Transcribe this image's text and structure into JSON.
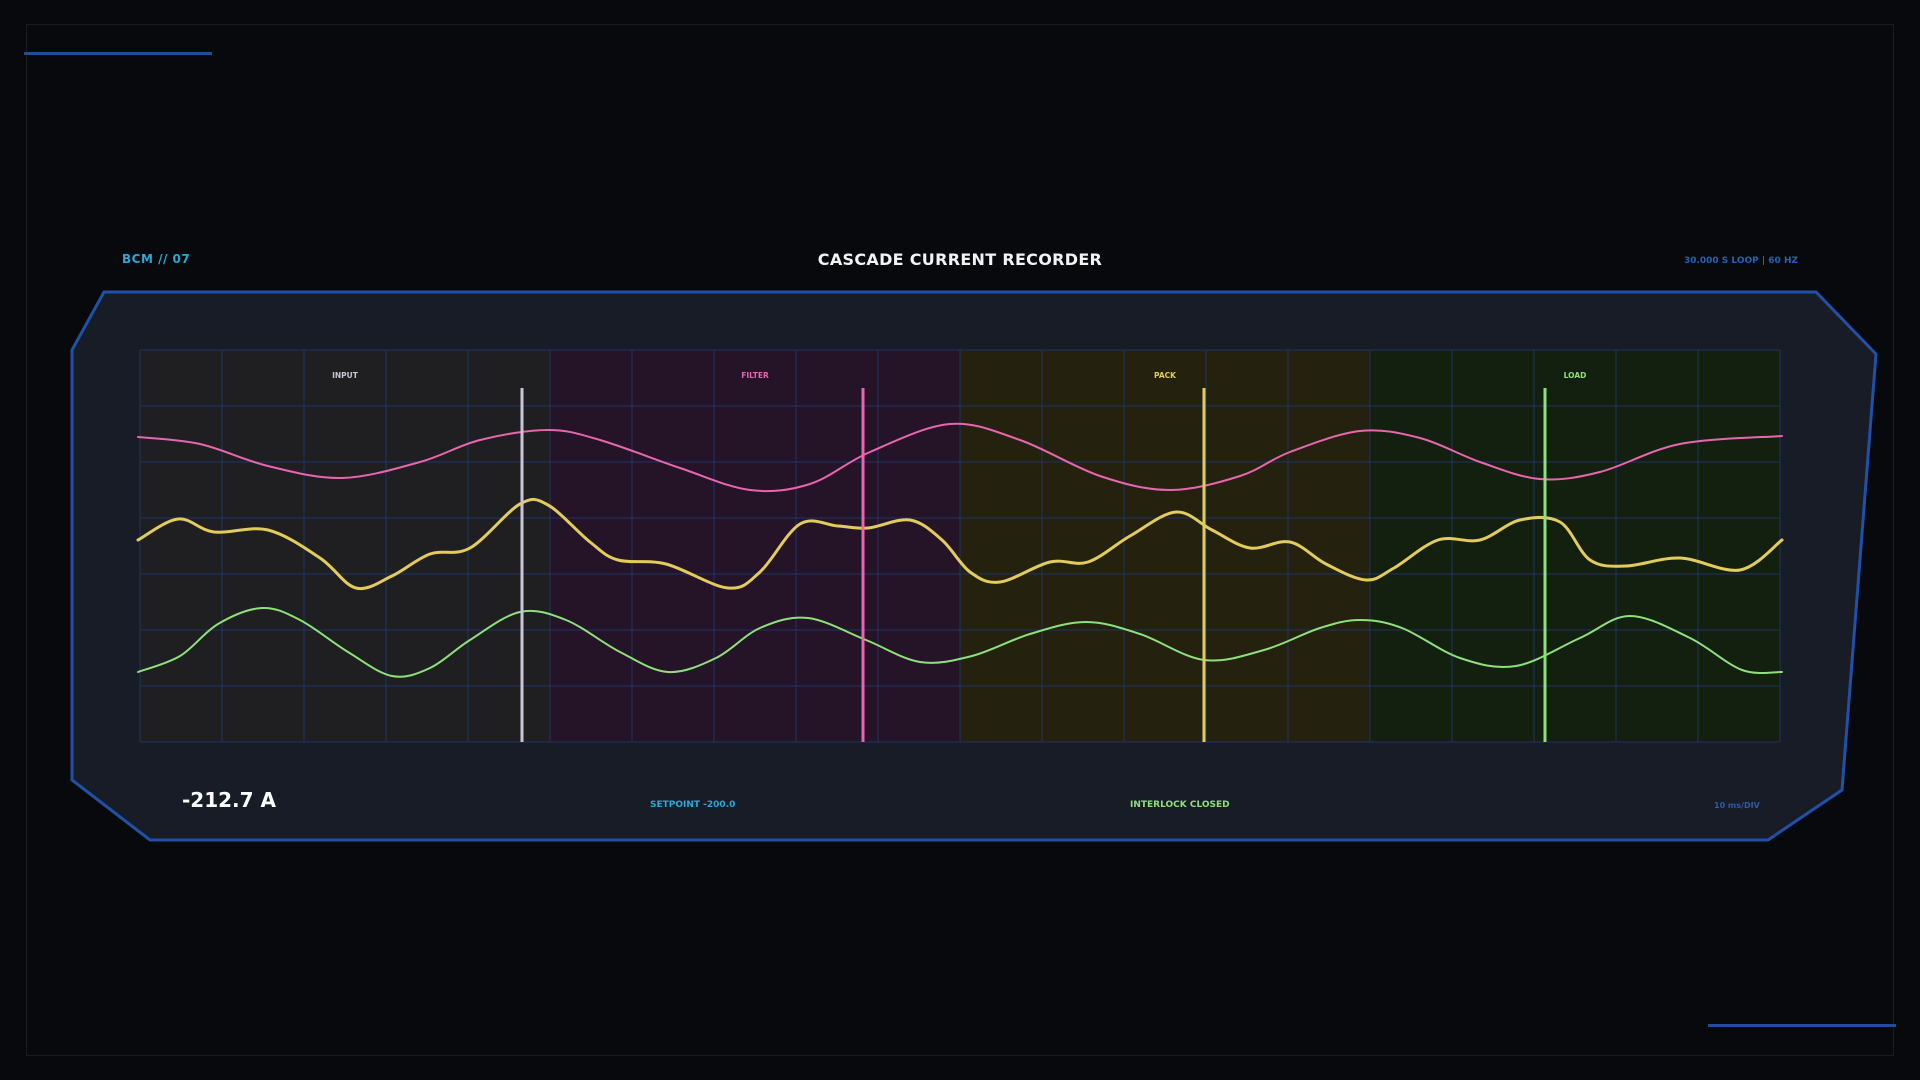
{
  "header": {
    "device_id": "BCM // 07",
    "title": "CASCADE CURRENT RECORDER",
    "loop_info": "30.000 S LOOP | 60 HZ"
  },
  "stages": [
    {
      "label": "INPUT",
      "color": "#c9c4d6",
      "tint": "#1f1f21"
    },
    {
      "label": "FILTER",
      "color": "#e866b0",
      "tint": "#251327"
    },
    {
      "label": "PACK",
      "color": "#e3cc5b",
      "tint": "#24210f"
    },
    {
      "label": "LOAD",
      "color": "#8ee07a",
      "tint": "#14200f"
    }
  ],
  "colors": {
    "panel_fill": "#181c26",
    "panel_border": "#2150a8",
    "grid": "#1d3566",
    "trace_top": "#e866b0",
    "trace_mid": "#e3cc5b",
    "trace_bot": "#8ee07a"
  },
  "footer": {
    "current_value": "-212.7 A",
    "setpoint": "SETPOINT -200.0",
    "interlock": "INTERLOCK CLOSED",
    "time_div": "10 ms/DIV"
  }
}
